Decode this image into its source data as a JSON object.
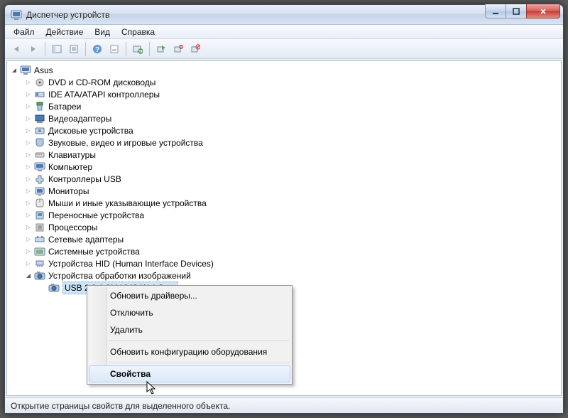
{
  "window": {
    "title": "Диспетчер устройств"
  },
  "menus": [
    "Файл",
    "Действие",
    "Вид",
    "Справка"
  ],
  "tree": {
    "root": "Asus",
    "categories": [
      "DVD и CD-ROM дисководы",
      "IDE ATA/ATAPI контроллеры",
      "Батареи",
      "Видеоадаптеры",
      "Дисковые устройства",
      "Звуковые, видео и игровые устройства",
      "Клавиатуры",
      "Компьютер",
      "Контроллеры USB",
      "Мониторы",
      "Мыши и иные указывающие устройства",
      "Переносные устройства",
      "Процессоры",
      "Сетевые адаптеры",
      "Системные устройства",
      "Устройства HID (Human Interface Devices)"
    ],
    "expanded_category": "Устройства обработки изображений",
    "selected_device": "USB 2.0 1.3M UVC WebCam"
  },
  "context_menu": {
    "items": [
      "Обновить драйверы...",
      "Отключить",
      "Удалить"
    ],
    "after_sep": "Обновить конфигурацию оборудования",
    "bold_item": "Свойства"
  },
  "statusbar": "Открытие страницы свойств для выделенного объекта."
}
